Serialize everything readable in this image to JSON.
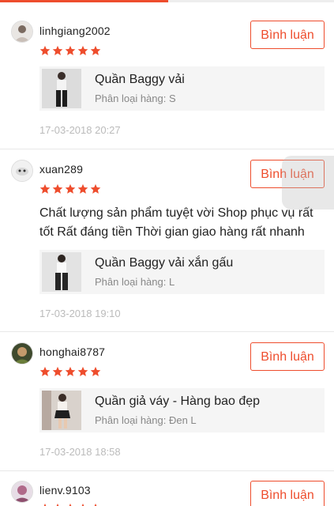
{
  "colors": {
    "accent": "#ee4d2d",
    "star": "#ee4d2d",
    "text": "#222222",
    "muted": "#888888",
    "timestamp": "#bbbbbb",
    "product_bg": "#f5f5f5"
  },
  "reviews": [
    {
      "username": "linhgiang2002",
      "rating": 5,
      "comment_button": "Bình luận",
      "text": "",
      "product_name": "Quần Baggy vải",
      "product_variant": "Phân loại hàng: S",
      "timestamp": "17-03-2018 20:27"
    },
    {
      "username": "xuan289",
      "rating": 5,
      "comment_button": "Bình luận",
      "text": "Chất lượng sản phẩm tuyệt vời Shop phục vụ rất tốt Rất đáng tiền Thời gian giao hàng rất nhanh",
      "product_name": "Quần Baggy vải xắn gấu",
      "product_variant": "Phân loại hàng: L",
      "timestamp": "17-03-2018 19:10"
    },
    {
      "username": "honghai8787",
      "rating": 5,
      "comment_button": "Bình luận",
      "text": "",
      "product_name": "Quần giả váy - Hàng bao đẹp",
      "product_variant": "Phân loại hàng: Đen L",
      "timestamp": "17-03-2018 18:58"
    },
    {
      "username": "lienv.9103",
      "rating": 5,
      "comment_button": "Bình luận",
      "text": "",
      "product_name": "",
      "product_variant": "",
      "timestamp": ""
    }
  ]
}
